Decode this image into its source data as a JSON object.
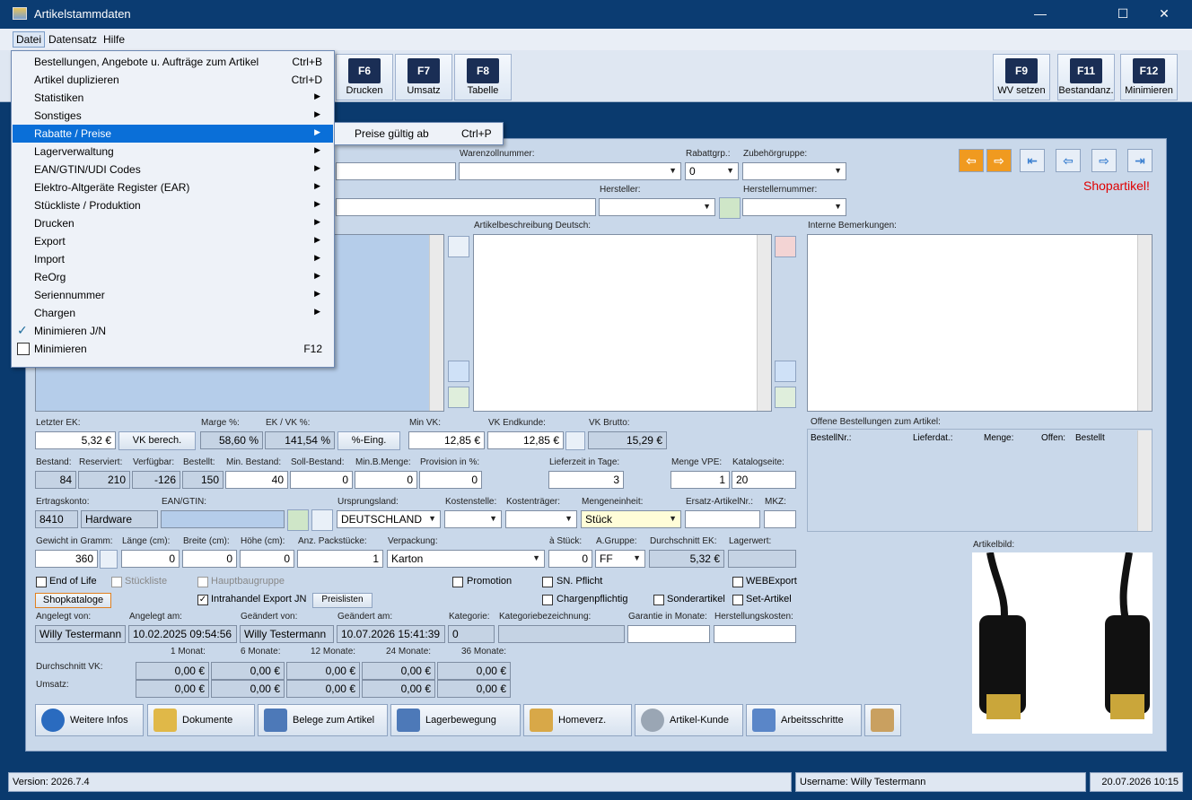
{
  "window": {
    "title": "Artikelstammdaten",
    "min": "—",
    "max": "☐",
    "close": "✕"
  },
  "menubar": {
    "datei": "Datei",
    "datensatz": "Datensatz",
    "hilfe": "Hilfe"
  },
  "toolbar": [
    {
      "key": "F6",
      "label": "Drucken"
    },
    {
      "key": "F7",
      "label": "Umsatz"
    },
    {
      "key": "F8",
      "label": "Tabelle"
    },
    {
      "key": "F9",
      "label": "WV setzen"
    },
    {
      "key": "F11",
      "label": "Bestandanz."
    },
    {
      "key": "F12",
      "label": "Minimieren"
    }
  ],
  "dropdown": [
    {
      "label": "Bestellungen, Angebote u. Aufträge zum Artikel",
      "shortcut": "Ctrl+B"
    },
    {
      "label": "Artikel duplizieren",
      "shortcut": "Ctrl+D"
    },
    {
      "label": "Statistiken",
      "arrow": "▶"
    },
    {
      "label": "Sonstiges",
      "arrow": "▶"
    },
    {
      "label": "Rabatte / Preise",
      "arrow": "▶"
    },
    {
      "label": "Lagerverwaltung",
      "arrow": "▶"
    },
    {
      "label": "EAN/GTIN/UDI Codes",
      "arrow": "▶"
    },
    {
      "label": "Elektro-Altgeräte Register (EAR)",
      "arrow": "▶"
    },
    {
      "label": "Stückliste / Produktion",
      "arrow": "▶"
    },
    {
      "label": "Drucken",
      "arrow": "▶"
    },
    {
      "label": "Export",
      "arrow": "▶"
    },
    {
      "label": "Import",
      "arrow": "▶"
    },
    {
      "label": "ReOrg",
      "arrow": "▶"
    },
    {
      "label": "Seriennummer",
      "arrow": "▶"
    },
    {
      "label": "Chargen",
      "arrow": "▶"
    },
    {
      "label": "Minimieren J/N",
      "check": "✓"
    },
    {
      "label": "Minimieren",
      "shortcut": "F12"
    }
  ],
  "submenu": {
    "label": "Preise gültig ab",
    "shortcut": "Ctrl+P"
  },
  "top_labels": {
    "warenzoll": "Warenzollnummer:",
    "rabattgrp": "Rabattgrp.:",
    "zubehoer": "Zubehörgruppe:",
    "hersteller": "Hersteller:",
    "herstellernr": "Herstellernummer:",
    "beschr_de": "Artikelbeschreibung Deutsch:",
    "interne": "Interne Bemerkungen:",
    "shopartikel": "Shopartikel!"
  },
  "top_values": {
    "rabattgrp": "0"
  },
  "nav": {
    "prev_orange": "⇦",
    "next_orange": "⇨",
    "first": "⇤",
    "back": "⇦",
    "fwd": "⇨",
    "last": "⇥"
  },
  "price": {
    "letzter_ek_l": "Letzter EK:",
    "letzter_ek": "5,32 €",
    "vk_berech": "VK berech.",
    "marge_l": "Marge %:",
    "marge": "58,60 %",
    "ekvk_l": "EK / VK %:",
    "ekvk": "141,54 %",
    "prozent_eing": "%-Eing.",
    "minvk_l": "Min VK:",
    "minvk": "12,85 €",
    "vkend_l": "VK Endkunde:",
    "vkend": "12,85 €",
    "vkbrutto_l": "VK Brutto:",
    "vkbrutto": "15,29 €"
  },
  "stock": {
    "labels": [
      "Bestand:",
      "Reserviert:",
      "Verfügbar:",
      "Bestellt:",
      "Min. Bestand:",
      "Soll-Bestand:",
      "Min.B.Menge:",
      "Provision in %:",
      "Lieferzeit in Tage:",
      "Menge VPE:",
      "Katalogseite:"
    ],
    "bestand": "84",
    "reserviert": "210",
    "verfuegbar": "-126",
    "bestellt": "150",
    "minbestand": "40",
    "sollbestand": "0",
    "minbmenge": "0",
    "provision": "0",
    "lieferzeit": "3",
    "mengevpe": "1",
    "katalogseite": "20"
  },
  "row3": {
    "labels": [
      "Ertragskonto:",
      "EAN/GTIN:",
      "Ursprungsland:",
      "Kostenstelle:",
      "Kostenträger:",
      "Mengeneinheit:",
      "Ersatz-ArtikelNr.:",
      "MKZ:"
    ],
    "konto": "8410",
    "konto_name": "Hardware",
    "land": "DEUTSCHLAND",
    "einheit": "Stück"
  },
  "row4": {
    "labels": [
      "Gewicht in Gramm:",
      "Länge (cm):",
      "Breite (cm):",
      "Höhe (cm):",
      "Anz. Packstücke:",
      "Verpackung:",
      "à Stück:",
      "A.Gruppe:",
      "Durchschnitt EK:",
      "Lagerwert:"
    ],
    "gewicht": "360",
    "laenge": "0",
    "breite": "0",
    "hoehe": "0",
    "pack": "1",
    "verpackung": "Karton",
    "astueck": "0",
    "agruppe": "FF",
    "dek": "5,32 €"
  },
  "checks": {
    "endoflife": "End of Life",
    "stueckliste": "Stückliste",
    "hauptbau": "Hauptbaugruppe",
    "promotion": "Promotion",
    "snpflicht": "SN. Pflicht",
    "webexport": "WEBExport",
    "shopkataloge": "Shopkataloge",
    "intrahandel": "Intrahandel Export JN",
    "preislisten": "Preislisten",
    "chargen": "Chargenpflichtig",
    "sonder": "Sonderartikel",
    "set": "Set-Artikel",
    "checkmark": "✓"
  },
  "audit": {
    "labels": [
      "Angelegt von:",
      "Angelegt am:",
      "Geändert von:",
      "Geändert am:",
      "Kategorie:",
      "Kategoriebezeichnung:",
      "Garantie in Monate:",
      "Herstellungskosten:"
    ],
    "angelegt_von": "Willy Testermann",
    "angelegt_am": "10.02.2025 09:54:56",
    "geaendert_von": "Willy Testermann",
    "geaendert_am": "10.07.2026 15:41:39",
    "kategorie": "0"
  },
  "averages": {
    "months": [
      "1 Monat:",
      "6 Monate:",
      "12 Monate:",
      "24 Monate:",
      "36 Monate:"
    ],
    "dek_label": "Durchschnitt VK:",
    "umsatz_label": "Umsatz:",
    "row1": [
      "0,00 €",
      "0,00 €",
      "0,00 €",
      "0,00 €",
      "0,00 €"
    ],
    "row2": [
      "0,00 €",
      "0,00 €",
      "0,00 €",
      "0,00 €",
      "0,00 €"
    ]
  },
  "orders": {
    "title": "Offene Bestellungen zum Artikel:",
    "cols": [
      "BestellNr.:",
      "Lieferdat.:",
      "Menge:",
      "Offen:",
      "Bestellt"
    ]
  },
  "image_label": "Artikelbild:",
  "bottom_buttons": [
    "Weitere Infos",
    "Dokumente",
    "Belege zum Artikel",
    "Lagerbewegung",
    "Homeverz.",
    "Artikel-Kunde",
    "Arbeitsschritte"
  ],
  "status": {
    "version": "Version: 2026.7.4",
    "user": "Username: Willy Testermann",
    "date": "20.07.2026 10:15"
  },
  "colors": {
    "accent": "#0a6fd8",
    "shop_red": "#e00000",
    "nav_orange": "#f0a030"
  }
}
